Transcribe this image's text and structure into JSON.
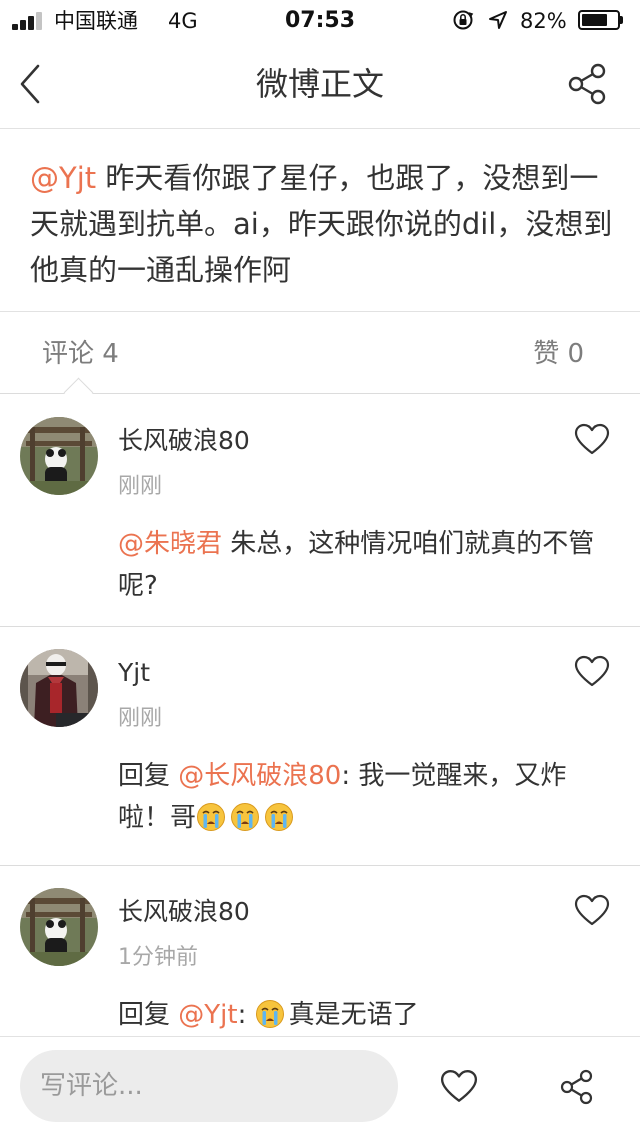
{
  "status_bar": {
    "carrier": "中国联通",
    "network": "4G",
    "time": "07:53",
    "battery_percent": "82%",
    "battery_level": 0.82,
    "signal_bars_active": 3,
    "icons": [
      "signal-icon",
      "orientation-lock-icon",
      "location-icon",
      "battery-icon"
    ]
  },
  "nav": {
    "title": "微博正文",
    "back_icon": "chevron-left-icon",
    "share_icon": "share-icon"
  },
  "post": {
    "mention": "@Yjt",
    "text": " 昨天看你跟了星仔，也跟了，没想到一天就遇到抗单。ai，昨天跟你说的dil，没想到他真的一通乱操作阿"
  },
  "tabs": {
    "comments_label": "评论 4",
    "likes_label": "赞 0",
    "active": "comments"
  },
  "comments": [
    {
      "username": "长风破浪80",
      "time": "刚刚",
      "prefix": "",
      "mention": "@朱晓君",
      "text": " 朱总，这种情况咱们就真的不管呢?",
      "emoji_count": 0,
      "suffix": ""
    },
    {
      "username": "Yjt",
      "time": "刚刚",
      "prefix": "回复 ",
      "mention": "@长风破浪80",
      "text": ": 我一觉醒来，又炸啦！哥",
      "emoji_count": 3,
      "suffix": ""
    },
    {
      "username": "长风破浪80",
      "time": "1分钟前",
      "prefix": "回复 ",
      "mention": "@Yjt",
      "text": ": ",
      "emoji_count": 1,
      "suffix": "真是无语了"
    }
  ],
  "bottom_bar": {
    "input_placeholder": "写评论...",
    "like_icon": "heart-icon",
    "share_icon": "share-icon"
  },
  "colors": {
    "accent": "#eb7350",
    "text": "#333333",
    "muted": "#a8a8a8",
    "divider": "#dcdcdc",
    "input_bg": "#ececec"
  }
}
